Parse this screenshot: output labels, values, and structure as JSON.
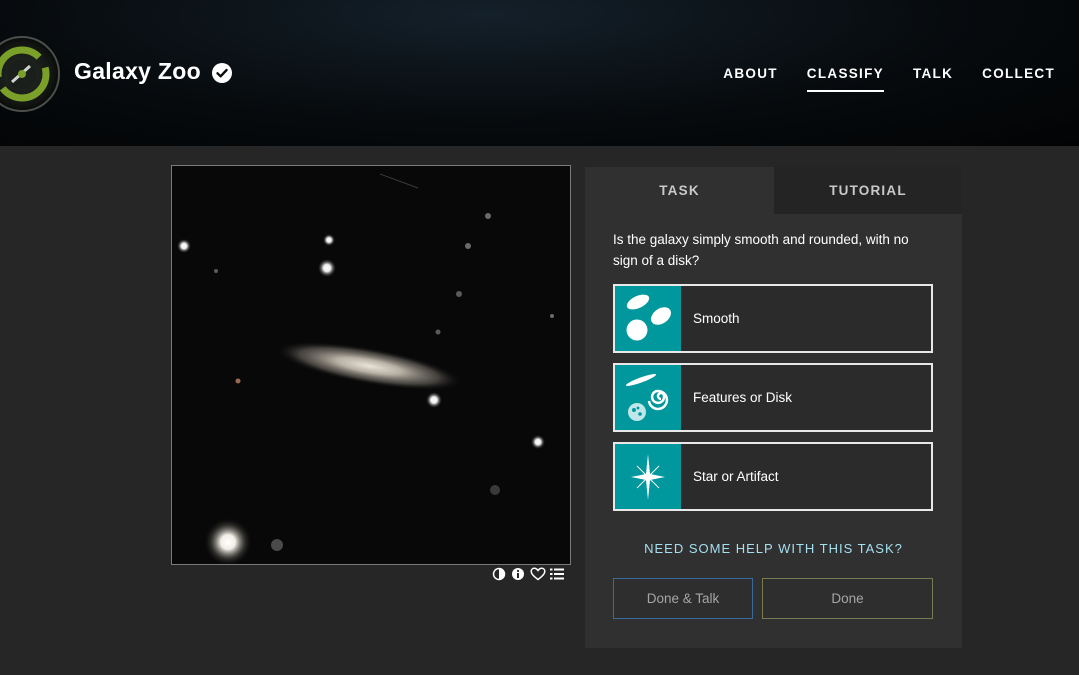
{
  "header": {
    "title": "Galaxy Zoo",
    "nav": [
      {
        "label": "ABOUT",
        "active": false
      },
      {
        "label": "CLASSIFY",
        "active": true
      },
      {
        "label": "TALK",
        "active": false
      },
      {
        "label": "COLLECT",
        "active": false
      }
    ]
  },
  "viewer": {
    "tools": [
      "invert-icon",
      "info-icon",
      "heart-icon",
      "collections-icon"
    ]
  },
  "panel": {
    "tabs": [
      "TASK",
      "TUTORIAL"
    ],
    "question": "Is the galaxy simply smooth and rounded, with no sign of a disk?",
    "answers": [
      {
        "label": "Smooth",
        "icon": "smooth-galaxy-icon"
      },
      {
        "label": "Features or Disk",
        "icon": "spiral-galaxy-icon"
      },
      {
        "label": "Star or Artifact",
        "icon": "star-icon"
      }
    ],
    "help": "NEED SOME HELP WITH THIS TASK?",
    "buttons": {
      "done_talk": "Done & Talk",
      "done": "Done"
    }
  },
  "colors": {
    "accent_teal": "#00979d",
    "background": "#262626",
    "panel": "#303030",
    "help_link": "#a6dff0"
  }
}
